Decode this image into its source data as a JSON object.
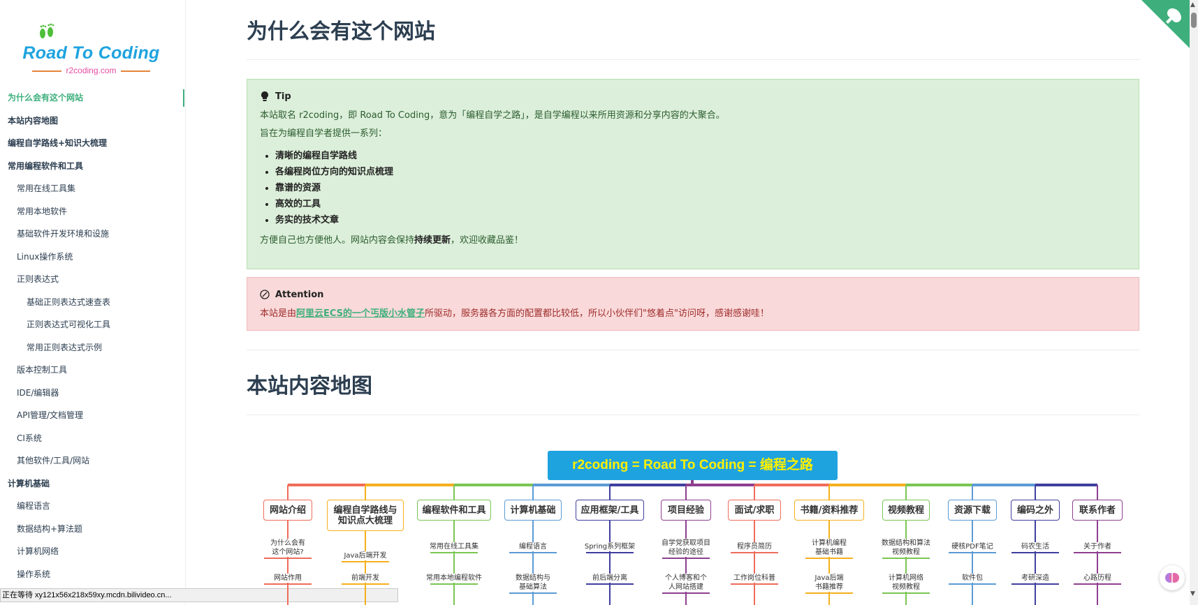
{
  "logo": {
    "title": "Road To Coding",
    "domain": "r2coding.com"
  },
  "sidebar": {
    "items": [
      {
        "label": "为什么会有这个网站",
        "level": 1,
        "active": true
      },
      {
        "label": "本站内容地图",
        "level": 1
      },
      {
        "label": "编程自学路线+知识大梳理",
        "level": 1
      },
      {
        "label": "常用编程软件和工具",
        "level": 1
      },
      {
        "label": "常用在线工具集",
        "level": 2
      },
      {
        "label": "常用本地软件",
        "level": 2
      },
      {
        "label": "基础软件开发环境和设施",
        "level": 2
      },
      {
        "label": "Linux操作系统",
        "level": 2
      },
      {
        "label": "正则表达式",
        "level": 2
      },
      {
        "label": "基础正则表达式速查表",
        "level": 3
      },
      {
        "label": "正则表达式可视化工具",
        "level": 3
      },
      {
        "label": "常用正则表达式示例",
        "level": 3
      },
      {
        "label": "版本控制工具",
        "level": 2
      },
      {
        "label": "IDE/编辑器",
        "level": 2
      },
      {
        "label": "API管理/文档管理",
        "level": 2
      },
      {
        "label": "CI系统",
        "level": 2
      },
      {
        "label": "其他软件/工具/网站",
        "level": 2
      },
      {
        "label": "计算机基础",
        "level": 1
      },
      {
        "label": "编程语言",
        "level": 2
      },
      {
        "label": "数据结构+算法题",
        "level": 2
      },
      {
        "label": "计算机网络",
        "level": 2
      },
      {
        "label": "操作系统",
        "level": 2
      }
    ]
  },
  "status_bar": "正在等待 xy121x56x218x59xy.mcdn.bilivideo.cn...",
  "section1": {
    "title": "为什么会有这个网站"
  },
  "tip": {
    "title": "Tip",
    "p1": "本站取名 r2coding，即 Road To Coding，意为「编程自学之路」，是自学编程以来所用资源和分享内容的大聚合。",
    "p2": "旨在为编程自学者提供一系列：",
    "items": [
      "清晰的编程自学路线",
      "各编程岗位方向的知识点梳理",
      "靠谱的资源",
      "高效的工具",
      "务实的技术文章"
    ],
    "p3_before": "方便自己也方便他人。网站内容会保持",
    "p3_bold": "持续更新",
    "p3_after": "，欢迎收藏品鉴！"
  },
  "attention": {
    "title": "Attention",
    "before": "本站是由",
    "link": "阿里云ECS的一个丐版小水管子",
    "after": "所驱动，服务器各方面的配置都比较低，所以小伙伴们\"悠着点\"访问呀，感谢感谢哇！"
  },
  "section2": {
    "title": "本站内容地图"
  },
  "mindmap": {
    "root": "r2coding = Road To Coding = 编程之路",
    "branches": [
      {
        "label": "网站介绍",
        "color": "#ef6c5a",
        "leaves": [
          "为什么会有\n这个网站?",
          "网站作用"
        ]
      },
      {
        "label": "编程自学路线与\n知识点大梳理",
        "color": "#f5b01d",
        "leaves": [
          "Java后端开发",
          "前端开发"
        ]
      },
      {
        "label": "编程软件和工具",
        "color": "#7ac553",
        "leaves": [
          "常用在线工具集",
          "常用本地编程软件"
        ]
      },
      {
        "label": "计算机基础",
        "color": "#5b9bd5",
        "leaves": [
          "编程语言",
          "数据结构与\n基础算法"
        ]
      },
      {
        "label": "应用框架/工具",
        "color": "#3f3f9f",
        "leaves": [
          "Spring系列框架",
          "前后端分离"
        ]
      },
      {
        "label": "项目经验",
        "color": "#8e3f8f",
        "leaves": [
          "自学党获取项目\n经验的途径",
          "个人博客和个\n人网站搭建"
        ]
      },
      {
        "label": "面试/求职",
        "color": "#ef6c5a",
        "leaves": [
          "程序员简历",
          "工作岗位科普"
        ]
      },
      {
        "label": "书籍/资料推荐",
        "color": "#f5b01d",
        "leaves": [
          "计算机编程\n基础书籍",
          "Java后端\n书籍推荐"
        ]
      },
      {
        "label": "视频教程",
        "color": "#7ac553",
        "leaves": [
          "数据结构和算法\n视频教程",
          "计算机网络\n视频教程"
        ]
      },
      {
        "label": "资源下载",
        "color": "#5b9bd5",
        "leaves": [
          "硬核PDF笔记",
          "软件包"
        ]
      },
      {
        "label": "编码之外",
        "color": "#3f3f9f",
        "leaves": [
          "码农生活",
          "考研深造"
        ]
      },
      {
        "label": "联系作者",
        "color": "#8e3f8f",
        "leaves": [
          "关于作者",
          "心路历程"
        ]
      }
    ]
  }
}
